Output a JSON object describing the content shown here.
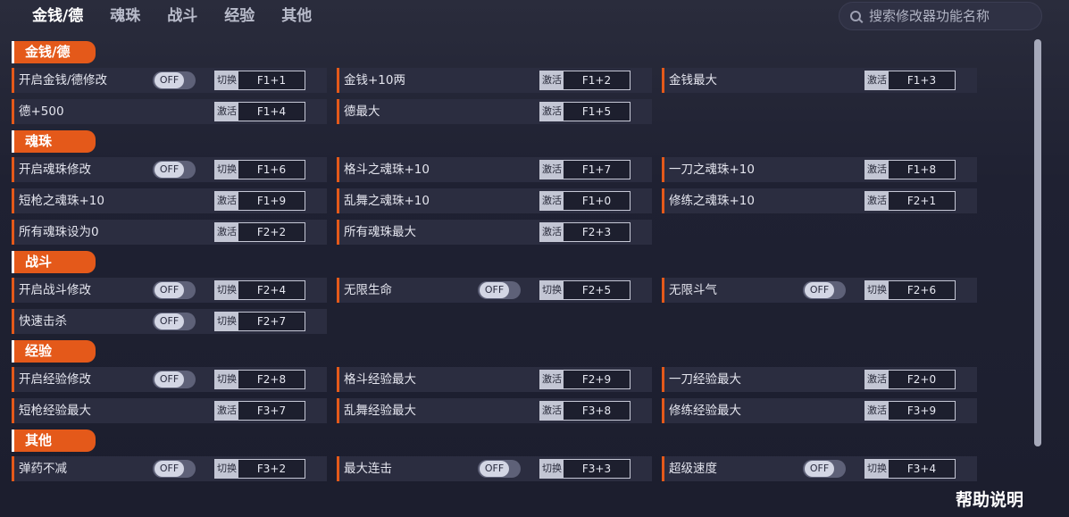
{
  "tabs": [
    "金钱/德",
    "魂珠",
    "战斗",
    "经验",
    "其他"
  ],
  "search": {
    "placeholder": "搜索修改器功能名称"
  },
  "sections": {
    "money": {
      "title": "金钱/德",
      "rows": [
        {
          "label": "开启金钱/德修改",
          "toggle": "OFF",
          "mode": "切换",
          "key": "F1+1"
        },
        {
          "label": "金钱+10两",
          "mode": "激活",
          "key": "F1+2"
        },
        {
          "label": "金钱最大",
          "mode": "激活",
          "key": "F1+3"
        },
        {
          "label": "德+500",
          "mode": "激活",
          "key": "F1+4"
        },
        {
          "label": "德最大",
          "mode": "激活",
          "key": "F1+5"
        }
      ]
    },
    "orbs": {
      "title": "魂珠",
      "rows": [
        {
          "label": "开启魂珠修改",
          "toggle": "OFF",
          "mode": "切换",
          "key": "F1+6"
        },
        {
          "label": "格斗之魂珠+10",
          "mode": "激活",
          "key": "F1+7"
        },
        {
          "label": "一刀之魂珠+10",
          "mode": "激活",
          "key": "F1+8"
        },
        {
          "label": "短枪之魂珠+10",
          "mode": "激活",
          "key": "F1+9"
        },
        {
          "label": "乱舞之魂珠+10",
          "mode": "激活",
          "key": "F1+0"
        },
        {
          "label": "修练之魂珠+10",
          "mode": "激活",
          "key": "F2+1"
        },
        {
          "label": "所有魂珠设为0",
          "mode": "激活",
          "key": "F2+2"
        },
        {
          "label": "所有魂珠最大",
          "mode": "激活",
          "key": "F2+3"
        }
      ]
    },
    "combat": {
      "title": "战斗",
      "rows": [
        {
          "label": "开启战斗修改",
          "toggle": "OFF",
          "mode": "切换",
          "key": "F2+4"
        },
        {
          "label": "无限生命",
          "toggle": "OFF",
          "mode": "切换",
          "key": "F2+5"
        },
        {
          "label": "无限斗气",
          "toggle": "OFF",
          "mode": "切换",
          "key": "F2+6"
        },
        {
          "label": "快速击杀",
          "toggle": "OFF",
          "mode": "切换",
          "key": "F2+7"
        }
      ]
    },
    "exp": {
      "title": "经验",
      "rows": [
        {
          "label": "开启经验修改",
          "toggle": "OFF",
          "mode": "切换",
          "key": "F2+8"
        },
        {
          "label": "格斗经验最大",
          "mode": "激活",
          "key": "F2+9"
        },
        {
          "label": "一刀经验最大",
          "mode": "激活",
          "key": "F2+0"
        },
        {
          "label": "短枪经验最大",
          "mode": "激活",
          "key": "F3+7"
        },
        {
          "label": "乱舞经验最大",
          "mode": "激活",
          "key": "F3+8"
        },
        {
          "label": "修练经验最大",
          "mode": "激活",
          "key": "F3+9"
        }
      ]
    },
    "other": {
      "title": "其他",
      "rows": [
        {
          "label": "弹药不减",
          "toggle": "OFF",
          "mode": "切换",
          "key": "F3+2"
        },
        {
          "label": "最大连击",
          "toggle": "OFF",
          "mode": "切换",
          "key": "F3+3"
        },
        {
          "label": "超级速度",
          "toggle": "OFF",
          "mode": "切换",
          "key": "F3+4"
        }
      ]
    }
  },
  "help_label": "帮助说明",
  "colors": {
    "accent": "#e4591a",
    "background": "#1d1f30",
    "row": "#2b2d40"
  },
  "icons": {
    "search": "search-icon"
  }
}
